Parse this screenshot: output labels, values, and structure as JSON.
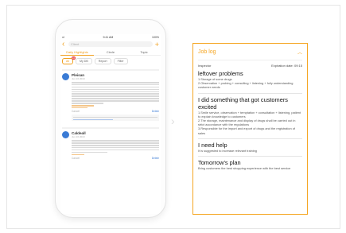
{
  "phone": {
    "status_left": "ııl",
    "status_time": "9:41 AM",
    "status_right": "100%",
    "search_placeholder": "Client",
    "tabs": [
      "Daily Highlights",
      "Circle",
      "Topic"
    ],
    "chips": [
      {
        "label": "All",
        "badge": "10"
      },
      {
        "label": "My DB",
        "badge": ""
      },
      {
        "label": "Report",
        "badge": ""
      },
      {
        "label": "Filter",
        "badge": ""
      }
    ],
    "posts": [
      {
        "name": "Pleisan",
        "date": "Jun 16 2019",
        "like_label": "Cancel",
        "share_label": "Delete"
      },
      {
        "name": "Caldeall",
        "date": "Jun 16 2019",
        "like_label": "Cancel",
        "share_label": "Delete"
      }
    ]
  },
  "job_log": {
    "title": "Job log",
    "inspector_label": "Inspector",
    "expiration": "Expiration date: 09:15",
    "sections": [
      {
        "heading": "leftover problems",
        "body": "1.Storage of some drugs\n2.Observation + probing + consulting + listening + fully understanding customer needs"
      },
      {
        "heading": "I did something that got customers excited",
        "body": "1.Smile service, observation + temptation + consultation + listening, patient to explain knowledge to customers\n2.The storage, maintenance and display of drugs shall be carried out in strict accordance with the regulations\n3.Responsible for the import and export of drugs and the registration of sales"
      },
      {
        "heading": "I need help",
        "body": "It is suggested to increase relevant training"
      },
      {
        "heading": "Tomorrow's plan",
        "body": "Bring customers the best shopping experience with the best service"
      }
    ]
  }
}
